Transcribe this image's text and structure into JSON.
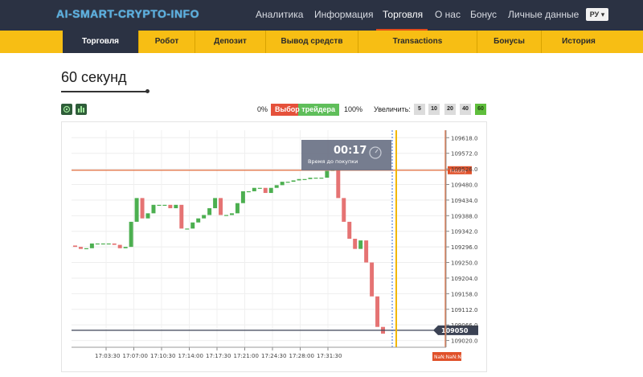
{
  "header": {
    "logo": "AI-SMART-CRYPTO-INFO",
    "nav": [
      {
        "label": "Аналитика"
      },
      {
        "label": "Информация"
      },
      {
        "label": "Торговля"
      },
      {
        "label": "О нас"
      },
      {
        "label": "Бонус"
      },
      {
        "label": "Личные данные"
      }
    ],
    "lang": "РУ ▾"
  },
  "subnav": {
    "tabs": [
      {
        "label": "Торговля"
      },
      {
        "label": "Робот"
      },
      {
        "label": "Депозит"
      },
      {
        "label": "Вывод средств"
      },
      {
        "label": "Transactions"
      },
      {
        "label": "Бонусы"
      },
      {
        "label": "История"
      }
    ]
  },
  "page": {
    "title": "60 секунд"
  },
  "toolbar": {
    "pct_min": "0%",
    "pct_max": "100%",
    "trader_choice": "Выбор трейдера",
    "zoom_label": "Увеличить:",
    "zoom_options": [
      "5",
      "10",
      "20",
      "40",
      "60"
    ],
    "zoom_selected": "60"
  },
  "timer": {
    "time": "00:17",
    "label": "Время до покупки"
  },
  "chart_data": {
    "type": "candlestick",
    "y_ticks": [
      "109618.0",
      "109572.0",
      "109526.0",
      "109480.0",
      "109434.0",
      "109388.0",
      "109342.0",
      "109296.0",
      "109250.0",
      "109204.0",
      "109158.0",
      "109112.0",
      "109066.0",
      "109020.0"
    ],
    "ylim": [
      109000,
      109640
    ],
    "x_ticks": [
      "17:03:30",
      "17:07:00",
      "17:10:30",
      "17:14:00",
      "17:17:30",
      "17:21:00",
      "17:24:30",
      "17:28:00",
      "17:31:30"
    ],
    "current_price_label": "109050",
    "current_price": 109050,
    "marker_label": "Industry",
    "marker_price": 109522,
    "bottom_marker_label": "NaN:NaN:NaN",
    "candles": [
      [
        109300,
        109296
      ],
      [
        109296,
        109290
      ],
      [
        109290,
        109292
      ],
      [
        109292,
        109306
      ],
      [
        109306,
        109306
      ],
      [
        109306,
        109306
      ],
      [
        109306,
        109306
      ],
      [
        109306,
        109302
      ],
      [
        109302,
        109292
      ],
      [
        109292,
        109296
      ],
      [
        109296,
        109370
      ],
      [
        109370,
        109440
      ],
      [
        109440,
        109380
      ],
      [
        109380,
        109395
      ],
      [
        109395,
        109420
      ],
      [
        109420,
        109420
      ],
      [
        109420,
        109420
      ],
      [
        109420,
        109410
      ],
      [
        109410,
        109420
      ],
      [
        109420,
        109350
      ],
      [
        109350,
        109350
      ],
      [
        109350,
        109368
      ],
      [
        109368,
        109380
      ],
      [
        109380,
        109390
      ],
      [
        109390,
        109410
      ],
      [
        109410,
        109440
      ],
      [
        109440,
        109390
      ],
      [
        109390,
        109390
      ],
      [
        109390,
        109395
      ],
      [
        109395,
        109425
      ],
      [
        109425,
        109460
      ],
      [
        109460,
        109460
      ],
      [
        109460,
        109470
      ],
      [
        109470,
        109470
      ],
      [
        109470,
        109455
      ],
      [
        109455,
        109470
      ],
      [
        109470,
        109478
      ],
      [
        109478,
        109488
      ],
      [
        109488,
        109488
      ],
      [
        109488,
        109492
      ],
      [
        109492,
        109496
      ],
      [
        109496,
        109496
      ],
      [
        109496,
        109500
      ],
      [
        109500,
        109500
      ],
      [
        109500,
        109500
      ],
      [
        109500,
        109520
      ],
      [
        109520,
        109525
      ],
      [
        109525,
        109440
      ],
      [
        109440,
        109370
      ],
      [
        109370,
        109320
      ],
      [
        109320,
        109290
      ],
      [
        109290,
        109315
      ],
      [
        109315,
        109250
      ],
      [
        109250,
        109150
      ],
      [
        109150,
        109060
      ],
      [
        109060,
        109040
      ]
    ]
  }
}
